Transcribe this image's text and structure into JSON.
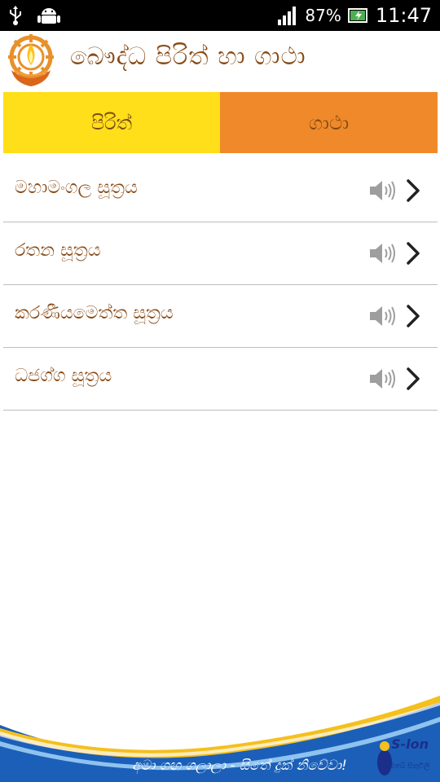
{
  "status_bar": {
    "battery_percent": "87%",
    "time": "11:47"
  },
  "header": {
    "title": "බෞද්ධ පිරිත් හා ගාථා"
  },
  "tabs": [
    {
      "label": "පිරිත්"
    },
    {
      "label": "ගාථා"
    }
  ],
  "list": {
    "items": [
      {
        "label": "මහාමංගල සූත්‍රය"
      },
      {
        "label": "රතන සූත්‍රය"
      },
      {
        "label": "කරණීයමෙත්ත සූත්‍රය"
      },
      {
        "label": "ධජග්ග සූත්‍රය"
      }
    ]
  },
  "banner": {
    "slogan": "අමා ගඟ ගලාලා - සිතේ දුක් නිවේවා!",
    "brand": "S-lon",
    "brand_sub": "ඔබේ සිතුවිලි"
  },
  "colors": {
    "tab_active": "#ffde1a",
    "tab_inactive": "#f0892a",
    "text_brown": "#8a4b16",
    "banner_blue": "#1b5fb8",
    "banner_yellow": "#f4c01e"
  }
}
